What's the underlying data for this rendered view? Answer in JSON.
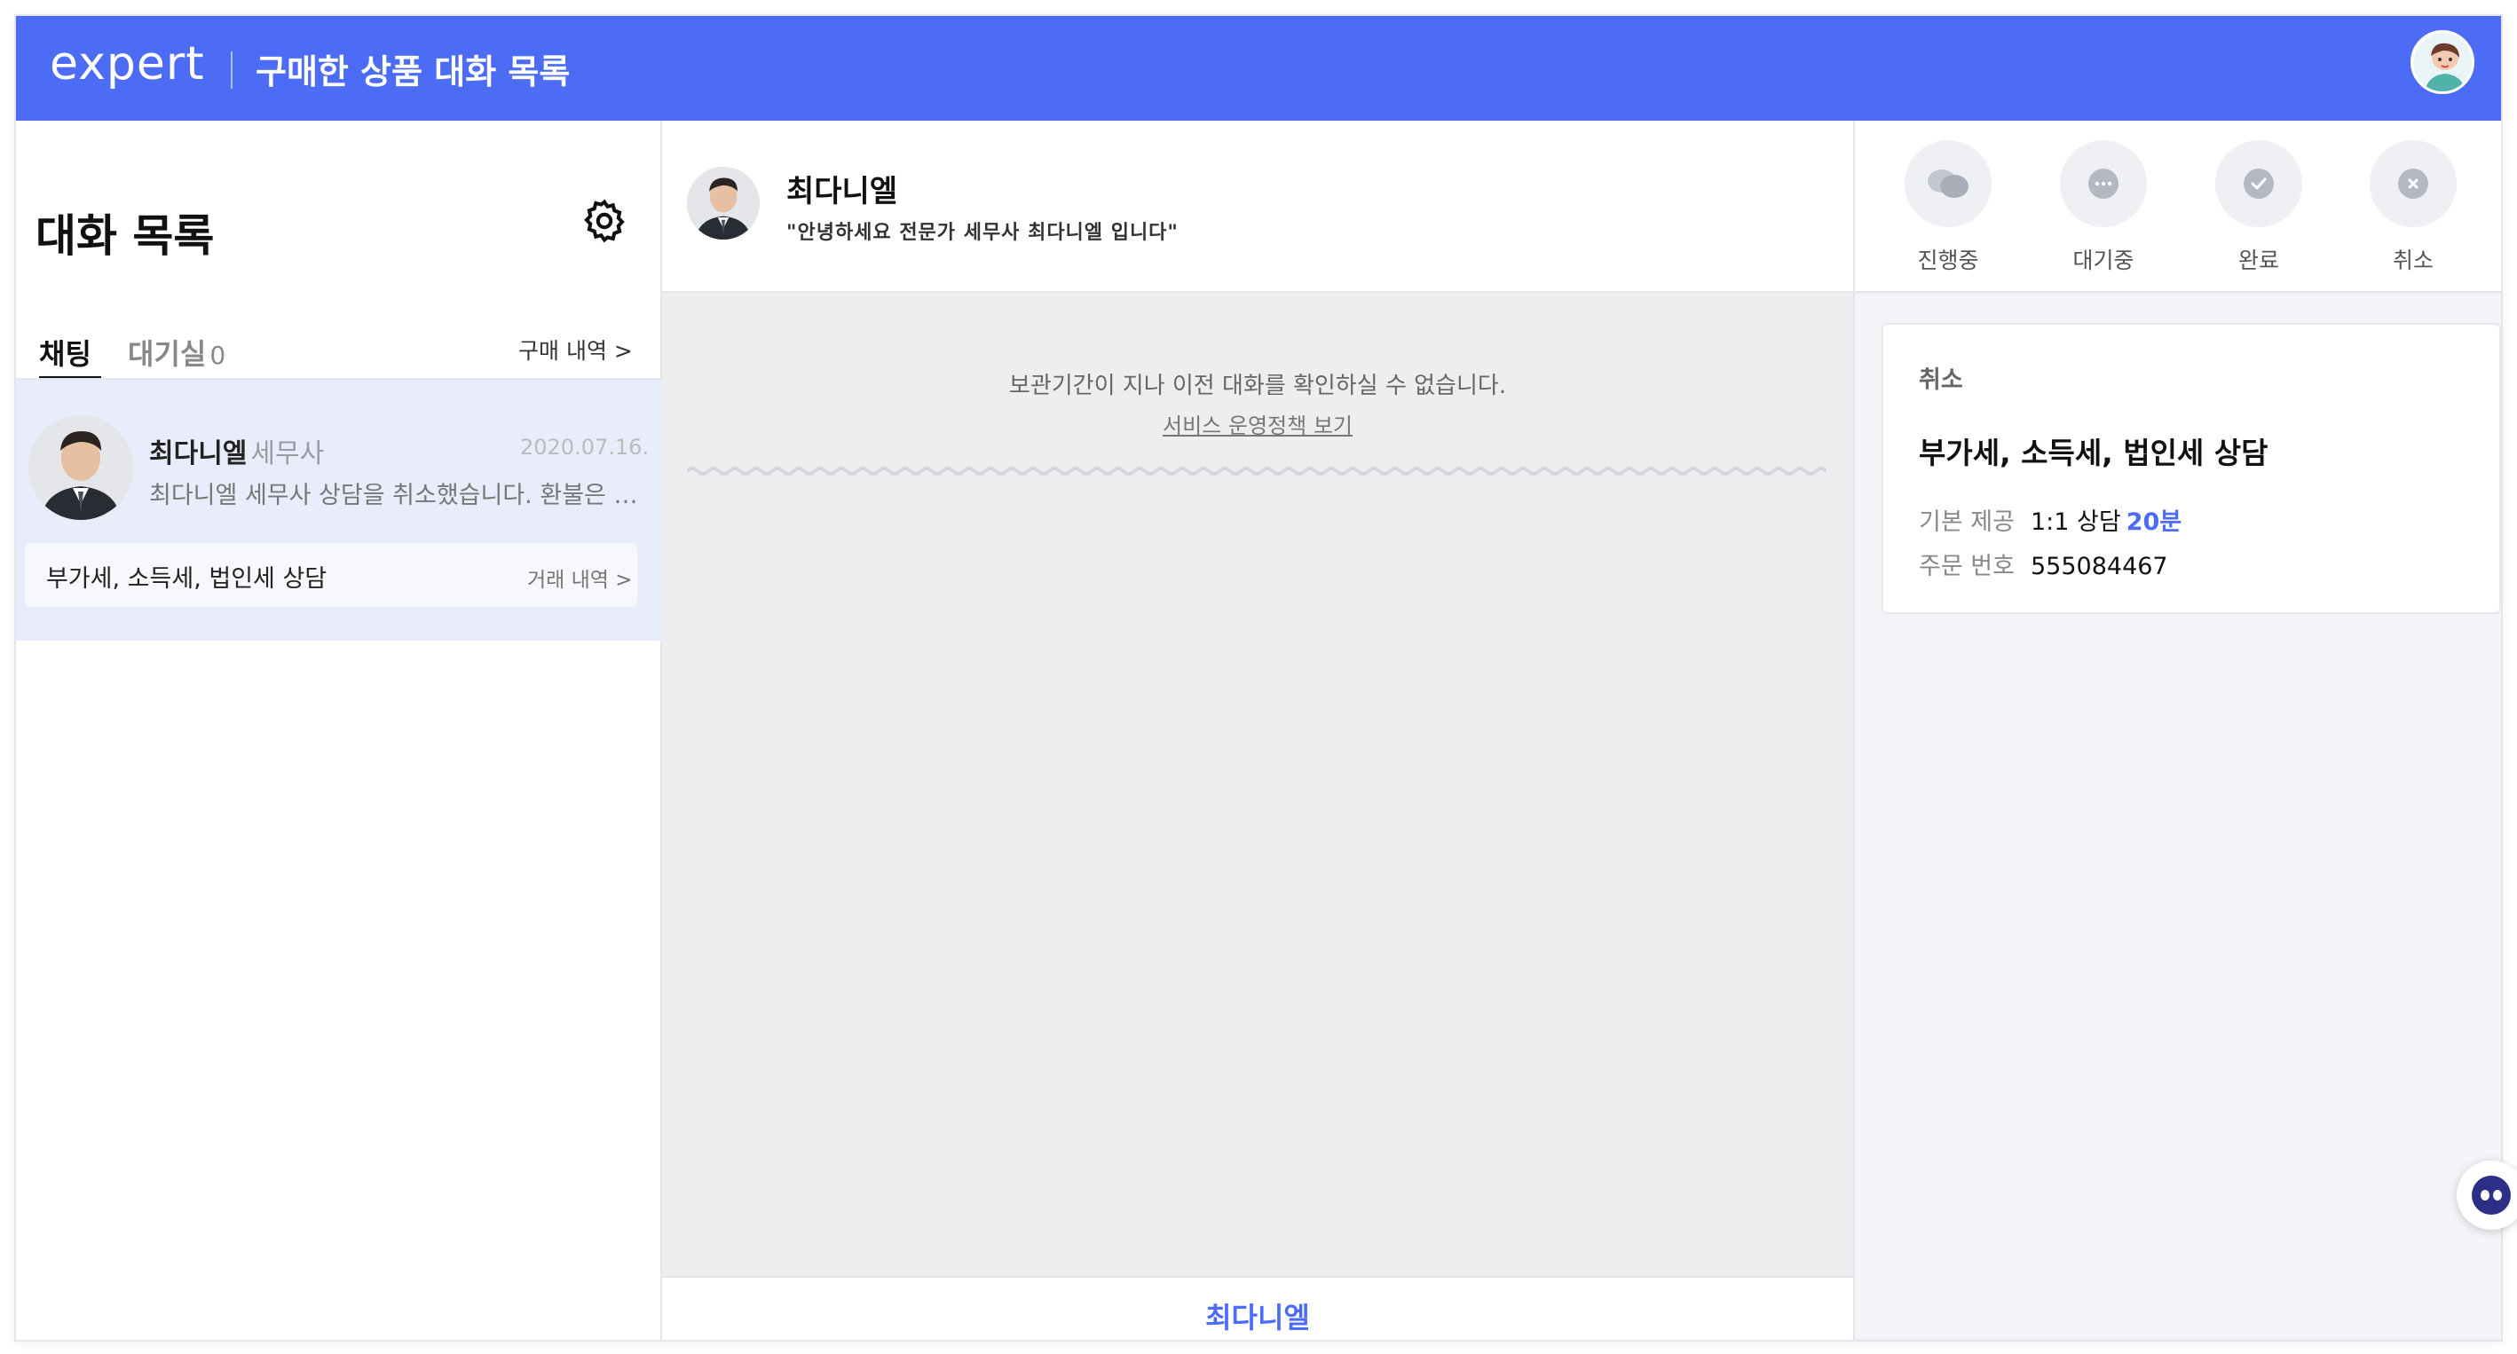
{
  "header": {
    "logo": "expert",
    "title": "구매한 상품 대화 목록"
  },
  "left": {
    "title": "대화 목록",
    "tabs": {
      "chat_label": "채팅",
      "waiting_label": "대기실",
      "waiting_count": "0",
      "purchase_history": "구매 내역 >"
    },
    "chat_item": {
      "name": "최다니엘",
      "role": "세무사",
      "date": "2020.07.16.",
      "preview": "최다니엘 세무사 상담을 취소했습니다. 환불은 결제...",
      "product": "부가세, 소득세, 법인세 상담",
      "trade_history": "거래 내역 >"
    }
  },
  "center": {
    "name": "최다니엘",
    "intro": "\"안녕하세요 전문가 세무사 최다니엘 입니다\"",
    "notice": "보관기간이 지나 이전 대화를 확인하실 수 없습니다.",
    "policy_link": "서비스 운영정책 보기",
    "footer_name": "최다니엘"
  },
  "right": {
    "statuses": [
      "진행중",
      "대기중",
      "완료",
      "취소"
    ],
    "card": {
      "status": "취소",
      "title": "부가세, 소득세, 법인세 상담",
      "basic_label": "기본 제공",
      "basic_value": "1:1 상담",
      "basic_time": "20분",
      "order_label": "주문 번호",
      "order_value": "555084467"
    }
  },
  "colors": {
    "brand": "#4c6cf6",
    "selected_bg": "#e9ecfb"
  },
  "icons": [
    "gear-icon",
    "chevron-right-icon",
    "chat-bubbles-icon",
    "ellipsis-icon",
    "check-icon",
    "x-icon",
    "chatbot-icon"
  ]
}
